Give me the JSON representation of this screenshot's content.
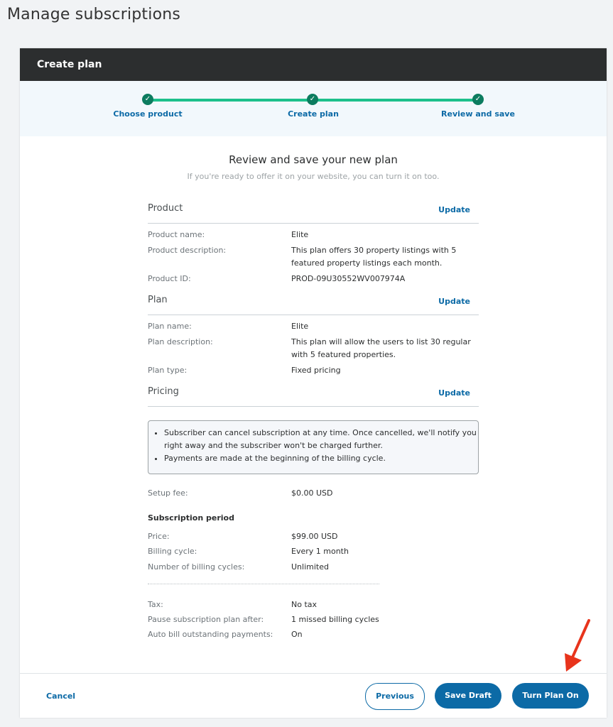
{
  "page": {
    "title": "Manage subscriptions"
  },
  "card": {
    "header": "Create plan"
  },
  "steps": [
    {
      "label": "Choose product"
    },
    {
      "label": "Create plan"
    },
    {
      "label": "Review and save"
    }
  ],
  "review": {
    "title": "Review and save your new plan",
    "subtitle": "If you're ready to offer it on your website, you can turn it on too."
  },
  "product": {
    "heading": "Product",
    "update_label": "Update",
    "rows": [
      {
        "key": "Product name:",
        "value": "Elite"
      },
      {
        "key": "Product description:",
        "value": "This plan offers 30 property listings with 5 featured property listings each month."
      },
      {
        "key": "Product ID:",
        "value": "PROD-09U30552WV007974A"
      }
    ]
  },
  "plan": {
    "heading": "Plan",
    "update_label": "Update",
    "rows": [
      {
        "key": "Plan name:",
        "value": "Elite"
      },
      {
        "key": "Plan description:",
        "value": "This plan will allow the users to list 30 regular with 5 featured properties."
      },
      {
        "key": "Plan type:",
        "value": "Fixed pricing"
      }
    ]
  },
  "pricing": {
    "heading": "Pricing",
    "update_label": "Update",
    "notes": [
      "Subscriber can cancel subscription at any time. Once cancelled, we'll notify you right away and the subscriber won't be charged further.",
      "Payments are made at the beginning of the billing cycle."
    ],
    "setup_fee": {
      "key": "Setup fee:",
      "value": "$0.00 USD"
    },
    "subscription_heading": "Subscription period",
    "period_rows": [
      {
        "key": "Price:",
        "value": "$99.00 USD"
      },
      {
        "key": "Billing cycle:",
        "value": "Every 1 month"
      },
      {
        "key": "Number of billing cycles:",
        "value": "Unlimited"
      }
    ],
    "extra_rows": [
      {
        "key": "Tax:",
        "value": "No tax"
      },
      {
        "key": "Pause subscription plan after:",
        "value": "1 missed billing cycles"
      },
      {
        "key": "Auto bill outstanding payments:",
        "value": "On"
      }
    ]
  },
  "footer": {
    "cancel_label": "Cancel",
    "previous_label": "Previous",
    "save_draft_label": "Save Draft",
    "turn_on_label": "Turn Plan On"
  },
  "colors": {
    "accent": "#0c6aa6",
    "step_line": "#1cc08b",
    "header_bg": "#2c2e2f",
    "arrow": "#e8341c"
  },
  "icons": {
    "step_done": "check-circle-icon",
    "annotation": "red-arrow-icon"
  }
}
